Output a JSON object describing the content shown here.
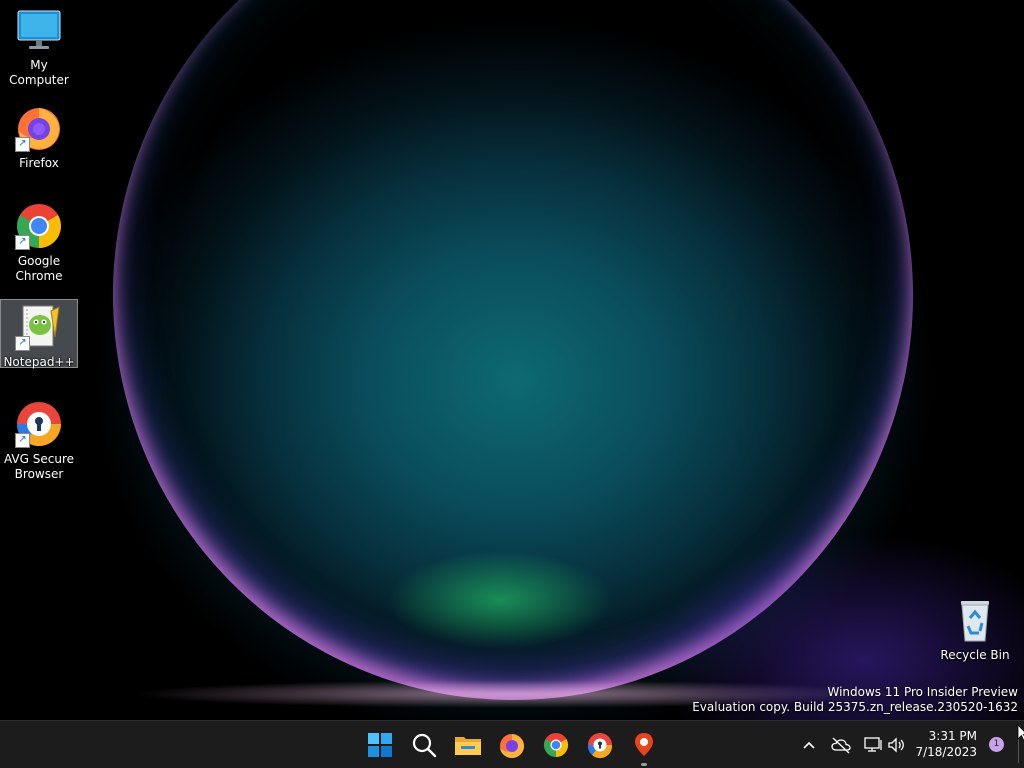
{
  "desktop": {
    "icons": [
      {
        "label": "My Computer"
      },
      {
        "label": "Firefox"
      },
      {
        "label": "Google Chrome"
      },
      {
        "label": "Notepad++"
      },
      {
        "label": "AVG Secure Browser"
      },
      {
        "label": "Recycle Bin"
      }
    ],
    "selected_icon": "Notepad++"
  },
  "watermark": {
    "line1": "Windows 11 Pro Insider Preview",
    "line2": "Evaluation copy. Build 25375.zn_release.230520-1632"
  },
  "taskbar": {
    "background": "#1c1c1c",
    "pinned": [
      {
        "icon": "start-icon"
      },
      {
        "icon": "search-icon"
      },
      {
        "icon": "file-explorer-icon"
      },
      {
        "icon": "firefox-icon"
      },
      {
        "icon": "chrome-icon"
      },
      {
        "icon": "avg-secure-browser-icon"
      },
      {
        "icon": "maps-pin-icon"
      }
    ],
    "tray": {
      "icons": [
        "chevron-up-icon",
        "cloud-offline-icon",
        "network-icon",
        "volume-icon"
      ],
      "time": "3:31 PM",
      "date": "7/18/2023",
      "notification_count": "1"
    }
  },
  "colors": {
    "accent": "#0078d4",
    "firefox_orange": "#ff7139",
    "chrome_red": "#ea4335",
    "chrome_green": "#34a853",
    "chrome_yellow": "#fbbc05",
    "chrome_blue": "#4285f4"
  }
}
